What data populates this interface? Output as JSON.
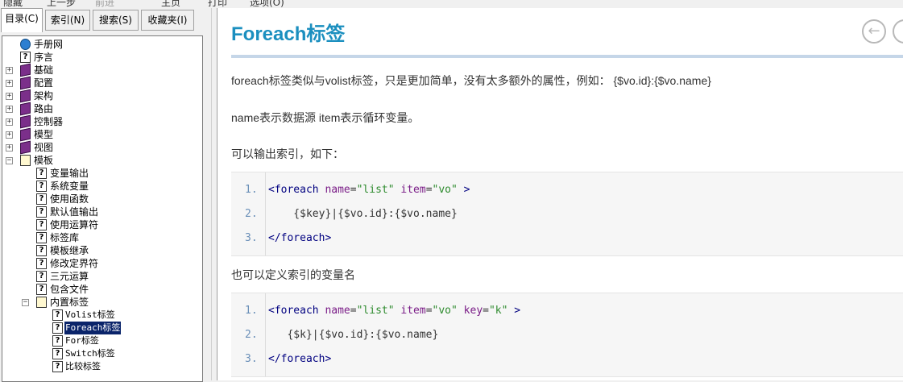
{
  "menubar": {
    "items": [
      "隐藏",
      "上一步",
      "前进",
      "主页",
      "打印",
      "选项(O)"
    ]
  },
  "tabs": [
    "目录(C)",
    "索引(N)",
    "搜索(S)",
    "收藏夹(I)"
  ],
  "tree": [
    {
      "label": "手册网",
      "icon": "globe"
    },
    {
      "label": "序言",
      "icon": "page"
    },
    {
      "label": "基础",
      "icon": "book"
    },
    {
      "label": "配置",
      "icon": "book"
    },
    {
      "label": "架构",
      "icon": "book"
    },
    {
      "label": "路由",
      "icon": "book"
    },
    {
      "label": "控制器",
      "icon": "book"
    },
    {
      "label": "模型",
      "icon": "book"
    },
    {
      "label": "视图",
      "icon": "book"
    },
    {
      "label": "模板",
      "icon": "open-book"
    },
    {
      "label": "变量输出",
      "icon": "page"
    },
    {
      "label": "系统变量",
      "icon": "page"
    },
    {
      "label": "使用函数",
      "icon": "page"
    },
    {
      "label": "默认值输出",
      "icon": "page"
    },
    {
      "label": "使用运算符",
      "icon": "page"
    },
    {
      "label": "标签库",
      "icon": "page"
    },
    {
      "label": "模板继承",
      "icon": "page"
    },
    {
      "label": "修改定界符",
      "icon": "page"
    },
    {
      "label": "三元运算",
      "icon": "page"
    },
    {
      "label": "包含文件",
      "icon": "page"
    },
    {
      "label": "内置标签",
      "icon": "open-book"
    },
    {
      "label": "Volist标签",
      "icon": "page"
    },
    {
      "label": "Foreach标签",
      "icon": "page",
      "selected": true
    },
    {
      "label": "For标签",
      "icon": "page"
    },
    {
      "label": "Switch标签",
      "icon": "page"
    },
    {
      "label": "比较标签",
      "icon": "page"
    }
  ],
  "content": {
    "title": "Foreach标签",
    "p1": "foreach标签类似与volist标签，只是更加简单，没有太多额外的属性，例如： {$vo.id}:{$vo.name}",
    "p2": "name表示数据源 item表示循环变量。",
    "p3": "可以输出索引，如下：",
    "p4": "也可以定义索引的变量名",
    "code1": {
      "line_numbers": [
        "1.",
        "2.",
        "3."
      ],
      "l1": {
        "open": "<foreach",
        "a1": "name",
        "v1": "\"list\"",
        "a2": "item",
        "v2": "\"vo\"",
        "close": ">"
      },
      "l2": "    {$key}|{$vo.id}:{$vo.name}",
      "l3": "</foreach>"
    },
    "code2": {
      "line_numbers": [
        "1.",
        "2.",
        "3."
      ],
      "l1": {
        "open": "<foreach",
        "a1": "name",
        "v1": "\"list\"",
        "a2": "item",
        "v2": "\"vo\"",
        "a3": "key",
        "v3": "\"k\"",
        "close": ">"
      },
      "l2": "   {$k}|{$vo.id}:{$vo.name}",
      "l3": "</foreach>"
    }
  },
  "colors": {
    "title": "#1b8fbf",
    "tag": "#000080",
    "attr": "#7a1c87",
    "value": "#2e8b2e",
    "selected": "#0a246a"
  }
}
